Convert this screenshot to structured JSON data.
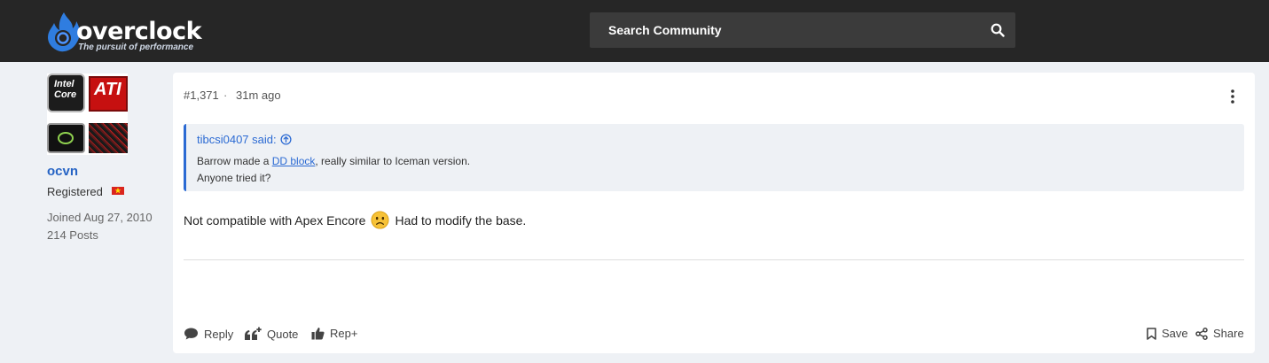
{
  "header": {
    "logo_text": "overclock",
    "logo_tagline": "The pursuit of performance",
    "search_label": "Search Community"
  },
  "user": {
    "avatar_badges": [
      "Intel Core",
      "ATI",
      "NVIDIA"
    ],
    "name": "ocvn",
    "role": "Registered",
    "joined": "Joined Aug 27, 2010",
    "posts": "214 Posts"
  },
  "post": {
    "number": "#1,371",
    "separator": "·",
    "time": "31m ago",
    "quote": {
      "author": "tibcsi0407 said:",
      "line1_before": "Barrow made a ",
      "line1_link": "DD block",
      "line1_after": ", really similar to Iceman version.",
      "line2": "Anyone tried it?"
    },
    "body_before": "Not compatible with Apex Encore",
    "body_after": "Had to modify the base."
  },
  "actions": {
    "reply": "Reply",
    "quote": "Quote",
    "rep": "Rep+",
    "save": "Save",
    "share": "Share"
  },
  "colors": {
    "header_bg": "#262626",
    "accent": "#2b6ad3",
    "username": "#2563c4"
  }
}
